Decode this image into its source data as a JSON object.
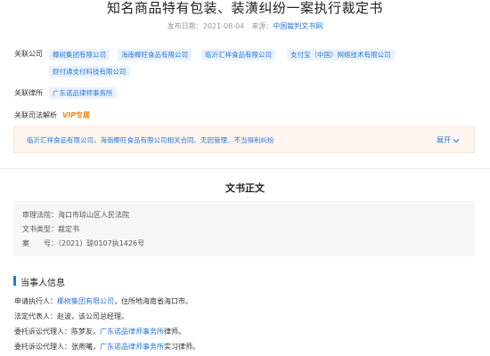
{
  "header": {
    "title": "知名商品特有包装、装潢纠纷一案执行裁定书",
    "publish_label": "发布日期：",
    "publish_date": "2021-08-04",
    "source_label": "来源：",
    "source": "中国裁判文书网"
  },
  "related_companies": {
    "label": "关联公司",
    "items": [
      "椰树集团有限公司",
      "海南椰旺食品有限公司",
      "临沂汇祥食品有限公司",
      "支付宝（中国）网络技术有限公司",
      "财付通支付科技有限公司"
    ]
  },
  "related_lawfirms": {
    "label": "关联律所",
    "items": [
      "广东诺品律师事务所"
    ]
  },
  "analysis": {
    "label": "关联司法解析",
    "vip": "VIP",
    "vip_suffix": "专属",
    "summary": "临沂汇祥食品有限公司，海南椰旺食品有限公司相关合同、无因管理、不当得利纠纷",
    "expand_label": "展开",
    "expand_icon": "chevron-down"
  },
  "document": {
    "heading": "文书正文",
    "info": [
      "审理法院：海口市琼山区人民法院",
      "文书类型：裁定书",
      "案　　号：（2021）琼0107执1426号"
    ]
  },
  "parties": {
    "heading": "当事人信息",
    "lines": [
      {
        "pre": "申请执行人：",
        "link": "椰树集团有限公司",
        "post": "，住所地海南省海口市。"
      },
      {
        "pre": "法定代表人：赵波，该公司总经理。",
        "link": "",
        "post": ""
      },
      {
        "pre": "委托诉讼代理人：陈梦友，",
        "link": "广东诺品律师事务所",
        "post": "律师。"
      },
      {
        "pre": "委托诉讼代理人：张燕曦，",
        "link": "广东诺品律师事务所",
        "post": "实习律师。"
      }
    ]
  },
  "colors": {
    "accent": "#2b76d6",
    "vip": "#f08a1c",
    "highlight_bg": "#fff6ef"
  }
}
